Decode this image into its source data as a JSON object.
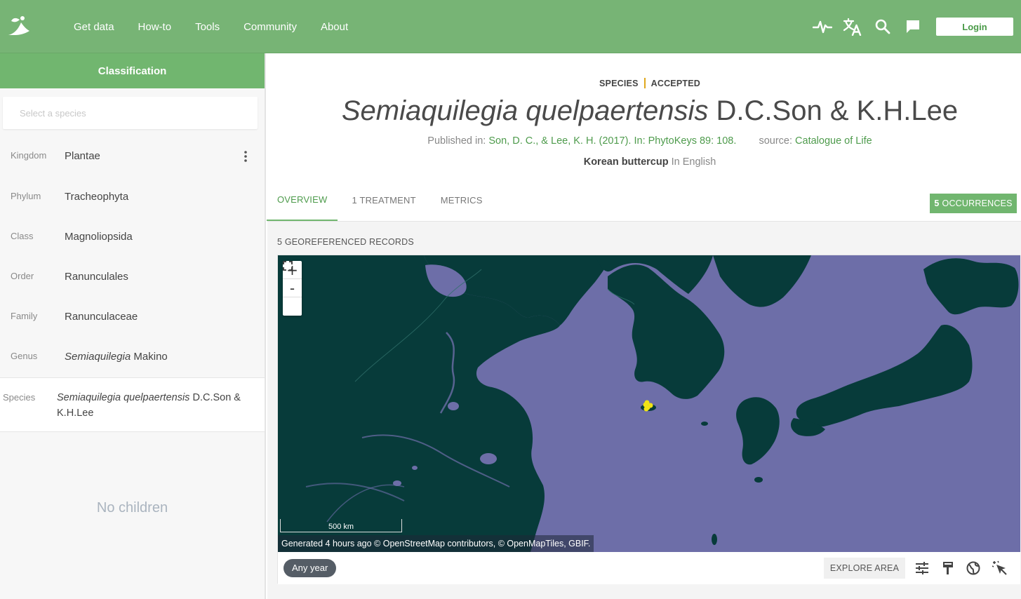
{
  "nav": {
    "links": [
      "Get data",
      "How-to",
      "Tools",
      "Community",
      "About"
    ],
    "icons": [
      "activity-icon",
      "translate-icon",
      "search-icon",
      "feedback-icon"
    ],
    "login": "Login"
  },
  "sidebar": {
    "title": "Classification",
    "search_placeholder": "Select a species",
    "ranks": [
      {
        "label": "Kingdom",
        "value": "Plantae"
      },
      {
        "label": "Phylum",
        "value": "Tracheophyta"
      },
      {
        "label": "Class",
        "value": "Magnoliopsida"
      },
      {
        "label": "Order",
        "value": "Ranunculales"
      },
      {
        "label": "Family",
        "value": "Ranunculaceae"
      },
      {
        "label": "Genus",
        "value_italic": "Semiaquilegia",
        "value_author": "Makino"
      }
    ],
    "species": {
      "label": "Species",
      "value_italic": "Semiaquilegia quelpaertensis",
      "value_author": "D.C.Son & K.H.Lee"
    },
    "no_children": "No children"
  },
  "taxon": {
    "rank": "SPECIES",
    "status": "ACCEPTED",
    "name_italic": "Semiaquilegia quelpaertensis",
    "author": "D.C.Son & K.H.Lee",
    "published_label": "Published in:",
    "published_in": "Son, D. C., & Lee, K. H. (2017). In: PhytoKeys 89: 108.",
    "source_label": "source:",
    "source": "Catalogue of Life",
    "vernacular": "Korean buttercup",
    "vernacular_lang": "In English"
  },
  "tabs": [
    "OVERVIEW",
    "1 TREATMENT",
    "METRICS"
  ],
  "occurrences": {
    "count": "5",
    "label": "OCCURRENCES"
  },
  "map": {
    "records_label": "5 GEOREFERENCED RECORDS",
    "zoom_in": "+",
    "zoom_out": "-",
    "scale": "500 km",
    "attribution": "Generated 4 hours ago © OpenStreetMap contributors, © OpenMapTiles, GBIF.",
    "year_filter": "Any year",
    "explore": "EXPLORE AREA",
    "tools": [
      "filter-icon",
      "style-brush-icon",
      "globe-icon",
      "select-pointer-icon"
    ],
    "colors": {
      "land": "#073b3a",
      "sea": "#6d6ea8",
      "points": "#f2e414"
    }
  },
  "colors": {
    "brand_green": "#77b475",
    "accent_gold": "#e0a81c",
    "link_green": "#4e9b4c"
  }
}
